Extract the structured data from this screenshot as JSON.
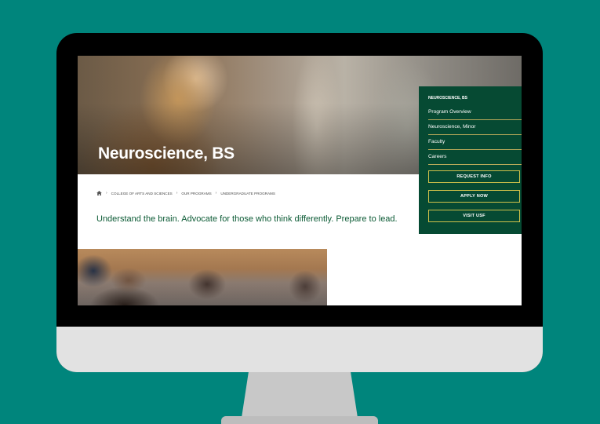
{
  "hero": {
    "title": "Neuroscience, BS"
  },
  "breadcrumb": {
    "items": [
      "College of Arts and Sciences",
      "Our Programs",
      "Undergraduate Programs"
    ],
    "separator": "›"
  },
  "tagline": "Understand the brain. Advocate for those who think differently. Prepare to lead.",
  "side_nav": {
    "heading": "Neuroscience, BS",
    "items": [
      {
        "label": "Program Overview"
      },
      {
        "label": "Neuroscience, Minor"
      },
      {
        "label": "Faculty"
      },
      {
        "label": "Careers"
      }
    ],
    "buttons": [
      {
        "label": "Request Info"
      },
      {
        "label": "Apply Now"
      },
      {
        "label": "Visit USF"
      }
    ]
  },
  "icons": {
    "home": "home-icon"
  },
  "colors": {
    "background": "#00857c",
    "brand_green": "#064a33",
    "accent_gold": "#cfc04a",
    "text_green": "#0b5a34"
  }
}
